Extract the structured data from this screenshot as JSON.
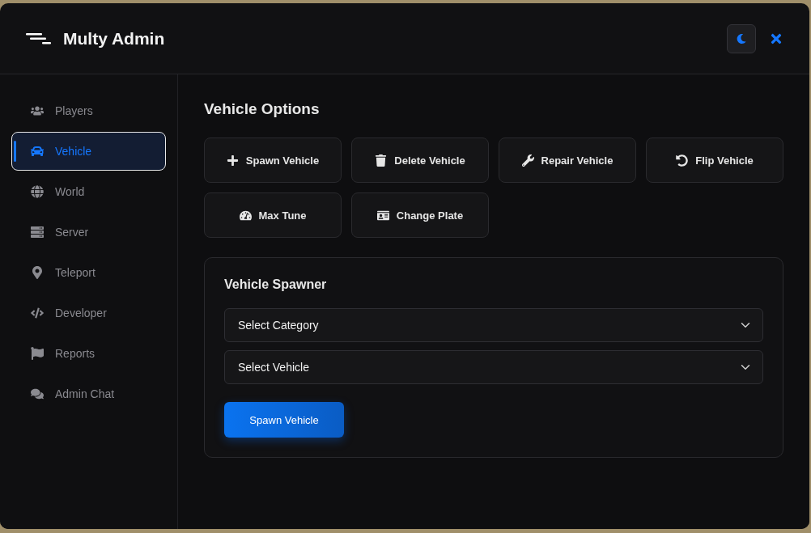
{
  "header": {
    "title": "Multy Admin"
  },
  "sidebar": {
    "items": [
      {
        "label": "Players",
        "selected": false
      },
      {
        "label": "Vehicle",
        "selected": true
      },
      {
        "label": "World",
        "selected": false
      },
      {
        "label": "Server",
        "selected": false
      },
      {
        "label": "Teleport",
        "selected": false
      },
      {
        "label": "Developer",
        "selected": false
      },
      {
        "label": "Reports",
        "selected": false
      },
      {
        "label": "Admin Chat",
        "selected": false
      }
    ]
  },
  "content": {
    "title": "Vehicle Options",
    "actions": [
      "Spawn Vehicle",
      "Delete Vehicle",
      "Repair Vehicle",
      "Flip Vehicle",
      "Max Tune",
      "Change Plate"
    ],
    "spawner": {
      "title": "Vehicle Spawner",
      "selects": [
        {
          "value": "Select Category"
        },
        {
          "value": "Select Vehicle"
        }
      ],
      "button": "Spawn Vehicle"
    }
  }
}
